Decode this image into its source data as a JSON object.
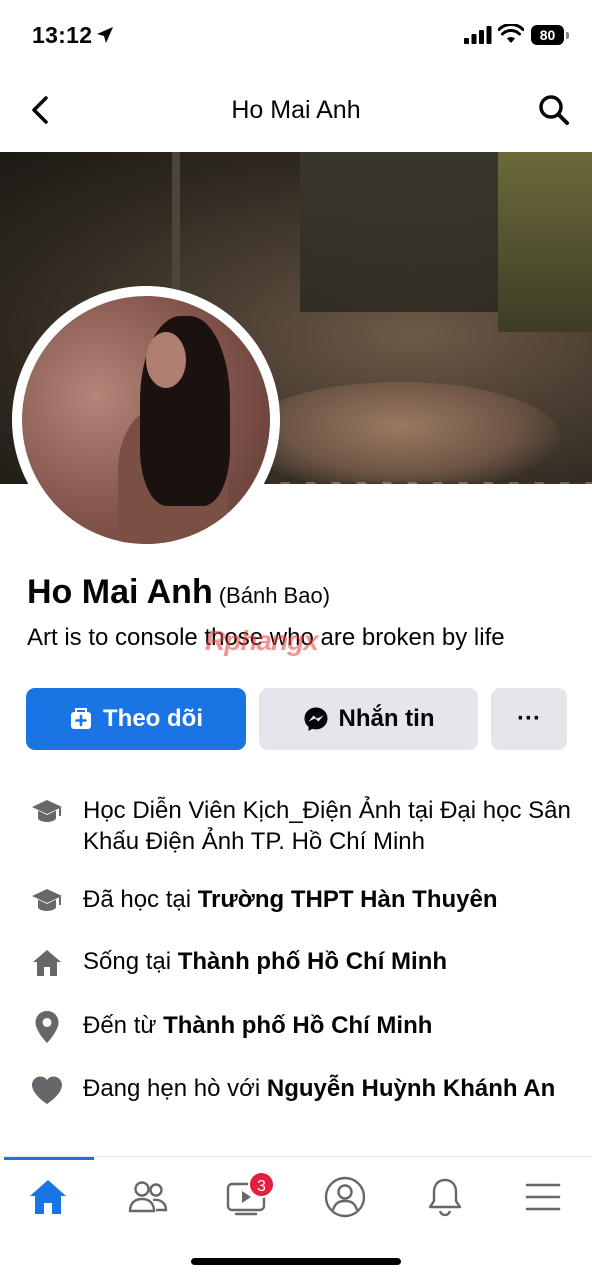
{
  "status_bar": {
    "time": "13:12",
    "battery": "80"
  },
  "nav": {
    "title": "Ho Mai Anh"
  },
  "profile": {
    "name": "Ho Mai Anh",
    "alt_name": "(Bánh Bao)",
    "bio": "Art is to console those who are broken by life",
    "watermark": "Rphangx"
  },
  "actions": {
    "follow_label": "Theo dõi",
    "message_label": "Nhắn tin",
    "more_label": "···"
  },
  "details": [
    {
      "icon": "graduation-cap-icon",
      "prefix": "Học Diễn Viên Kịch_Điện Ảnh tại Đại học Sân Khấu Điện Ảnh TP. Hồ Chí Minh",
      "bold": ""
    },
    {
      "icon": "graduation-cap-icon",
      "prefix": "Đã học tại ",
      "bold": "Trường THPT Hàn Thuyên"
    },
    {
      "icon": "house-icon",
      "prefix": "Sống tại ",
      "bold": "Thành phố Hồ Chí Minh"
    },
    {
      "icon": "location-pin-icon",
      "prefix": "Đến từ ",
      "bold": "Thành phố Hồ Chí Minh"
    },
    {
      "icon": "heart-icon",
      "prefix": "Đang hẹn hò với ",
      "bold": "Nguyễn Huỳnh Khánh An"
    }
  ],
  "tabbar": {
    "tabs": [
      "home",
      "friends",
      "watch",
      "profile",
      "notifications",
      "menu"
    ],
    "active": "home",
    "watch_badge": "3"
  },
  "colors": {
    "accent": "#1b74e4",
    "button_gray": "#e4e6eb",
    "badge_red": "#e41e3f"
  }
}
